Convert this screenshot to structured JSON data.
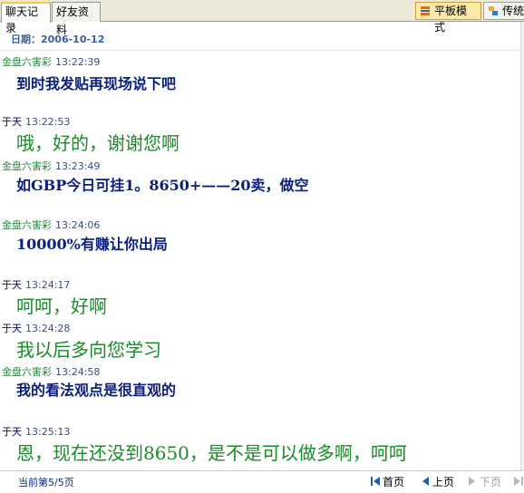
{
  "tabs": [
    {
      "label": "聊天记录",
      "active": true
    },
    {
      "label": "好友资料",
      "active": false
    }
  ],
  "modes": [
    {
      "label": "平板模式",
      "icon": "flat-mode-icon",
      "selected": true
    },
    {
      "label": "传统",
      "icon": "classic-mode-icon",
      "selected": false
    }
  ],
  "date_header": "日期：2006-10-12",
  "messages": [
    {
      "sender": "金盘六害彩",
      "time": "13:22:39",
      "text": "到时我发贴再现场说下吧"
    },
    {
      "sender": "于天",
      "time": "13:22:53",
      "text": "哦，好的，谢谢您啊"
    },
    {
      "sender": "金盘六害彩",
      "time": "13:23:49",
      "text": "如GBP今日可挂1。8650+——20卖，做空"
    },
    {
      "sender": "金盘六害彩",
      "time": "13:24:06",
      "text": "10000%有赚让你出局"
    },
    {
      "sender": "于天",
      "time": "13:24:17",
      "text": "呵呵，好啊"
    },
    {
      "sender": "于天",
      "time": "13:24:28",
      "text": "我以后多向您学习"
    },
    {
      "sender": "金盘六害彩",
      "time": "13:24:58",
      "text": "我的看法观点是很直观的"
    },
    {
      "sender": "于天",
      "time": "13:25:13",
      "text": "恩，现在还没到8650，是不是可以做多啊，呵呵"
    }
  ],
  "footer": {
    "page_info": "当前第5/5页",
    "first_label": "首页",
    "prev_label": "上页",
    "next_label": "下页",
    "colors": {
      "green": "#1a8a2a",
      "navy": "#0a1e7c",
      "nav_blue": "#1e5fb4"
    }
  }
}
